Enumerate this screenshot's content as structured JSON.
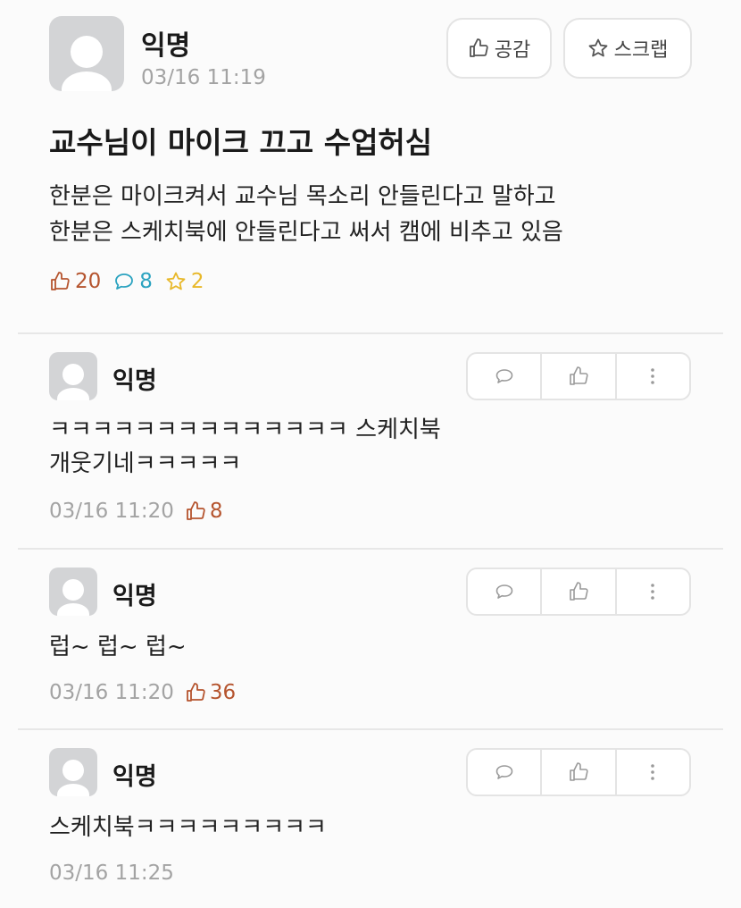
{
  "post": {
    "author": "익명",
    "time": "03/16 11:19",
    "like_button": "공감",
    "scrap_button": "스크랩",
    "title": "교수님이 마이크 끄고 수업허심",
    "body_lines": [
      "한분은 마이크켜서 교수님 목소리 안들린다고 말하고",
      "한분은 스케치북에 안들린다고 써서 캠에 비추고 있음"
    ],
    "likes": "20",
    "comments": "8",
    "scraps": "2"
  },
  "comments": [
    {
      "author": "익명",
      "lines": [
        "ㅋㅋㅋㅋㅋㅋㅋㅋㅋㅋㅋㅋㅋㅋ 스케치북",
        "개웃기네ㅋㅋㅋㅋㅋ"
      ],
      "time": "03/16 11:20",
      "likes": "8"
    },
    {
      "author": "익명",
      "lines": [
        "럽~ 럽~ 럽~"
      ],
      "time": "03/16 11:20",
      "likes": "36"
    },
    {
      "author": "익명",
      "lines": [
        "스케치북ㅋㅋㅋㅋㅋㅋㅋㅋㅋ"
      ],
      "time": "03/16 11:25",
      "likes": ""
    }
  ],
  "colors": {
    "like": "#b5542e",
    "comment": "#2ba3c0",
    "scrap": "#e8b829",
    "muted": "#a3a3a3"
  },
  "icons": {
    "like": "thumbs-up-icon",
    "comment": "speech-bubble-icon",
    "scrap": "star-icon",
    "more": "more-vertical-icon"
  }
}
